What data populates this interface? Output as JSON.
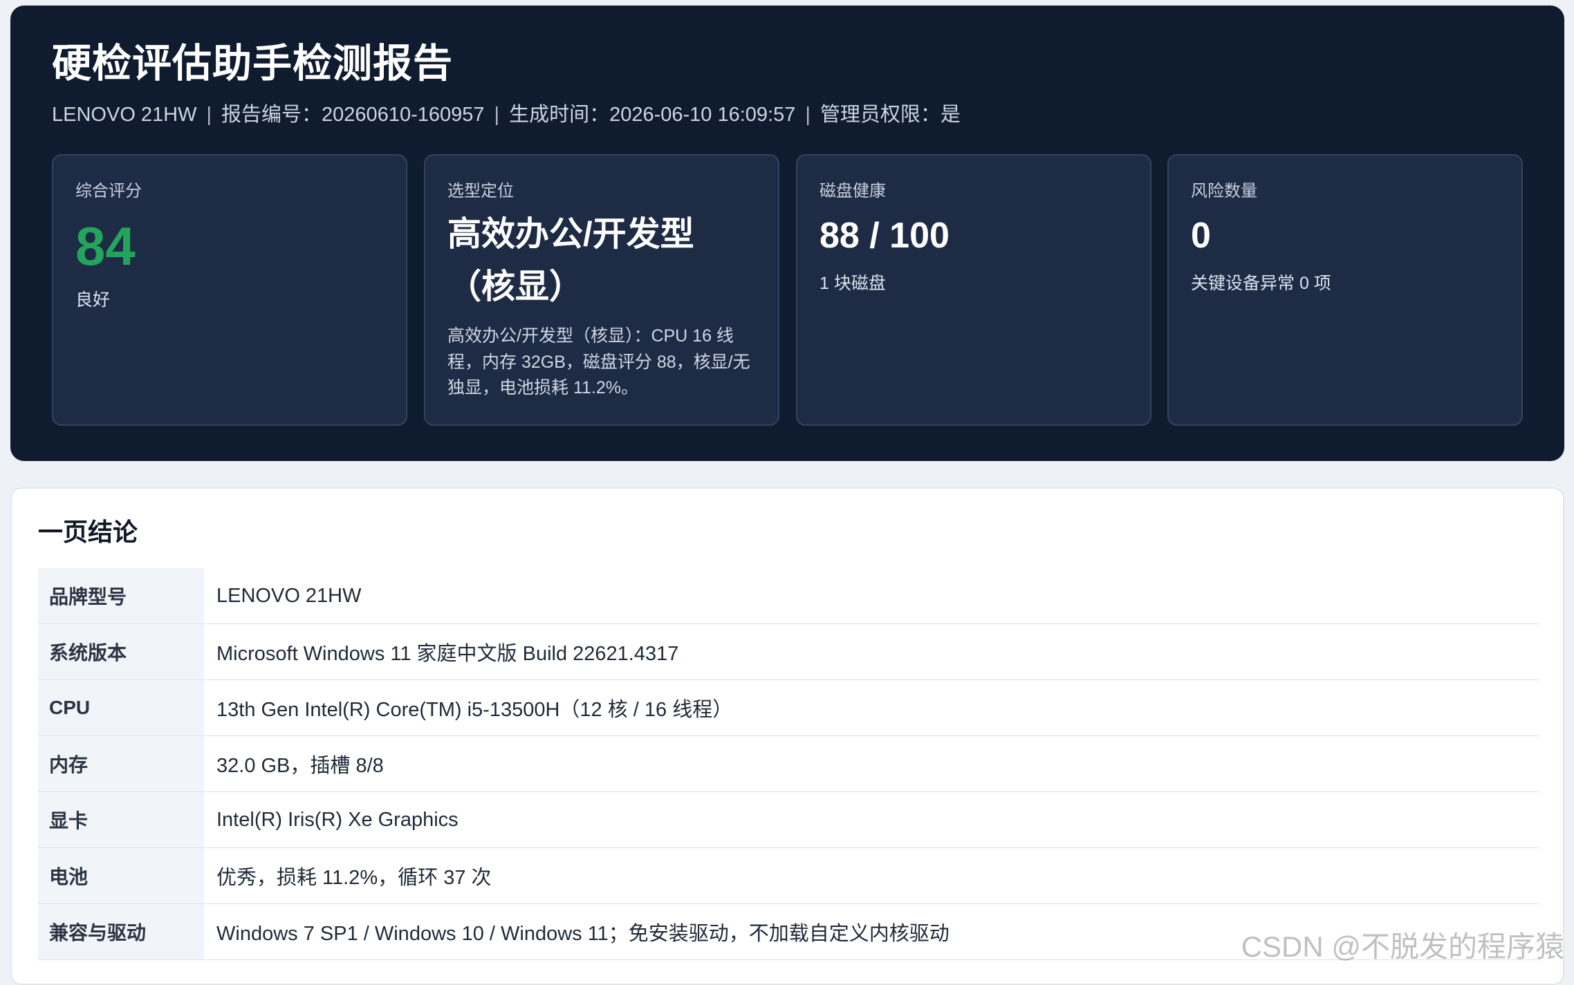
{
  "header": {
    "title": "硬检评估助手检测报告",
    "meta": {
      "device": "LENOVO 21HW",
      "separator": "|",
      "report_no": "报告编号：20260610-160957",
      "generated": "生成时间：2026-06-10 16:09:57",
      "admin": "管理员权限：是"
    }
  },
  "cards": {
    "score": {
      "label": "综合评分",
      "value": "84",
      "sub": "良好",
      "value_color": "#22a55b"
    },
    "positioning": {
      "label": "选型定位",
      "value_line1": "高效办公/开发型",
      "value_line2": "（核显）",
      "desc": "高效办公/开发型（核显）：CPU 16 线程，内存 32GB，磁盘评分 88，核显/无独显，电池损耗 11.2%。"
    },
    "disk": {
      "label": "磁盘健康",
      "value": "88 / 100",
      "sub": "1 块磁盘"
    },
    "risk": {
      "label": "风险数量",
      "value": "0",
      "sub": "关键设备异常 0 项"
    }
  },
  "summary": {
    "title": "一页结论",
    "rows": [
      {
        "key": "品牌型号",
        "value": "LENOVO 21HW"
      },
      {
        "key": "系统版本",
        "value": "Microsoft Windows 11 家庭中文版 Build 22621.4317"
      },
      {
        "key": "CPU",
        "value": "13th Gen Intel(R) Core(TM) i5-13500H（12 核 / 16 线程）"
      },
      {
        "key": "内存",
        "value": "32.0 GB，插槽 8/8"
      },
      {
        "key": "显卡",
        "value": "Intel(R) Iris(R) Xe Graphics"
      },
      {
        "key": "电池",
        "value": "优秀，损耗 11.2%，循环 37 次"
      },
      {
        "key": "兼容与驱动",
        "value": "Windows 7 SP1 / Windows 10 / Windows 11；免安装驱动，不加载自定义内核驱动"
      }
    ]
  },
  "watermark": "CSDN @不脱发的程序猿"
}
